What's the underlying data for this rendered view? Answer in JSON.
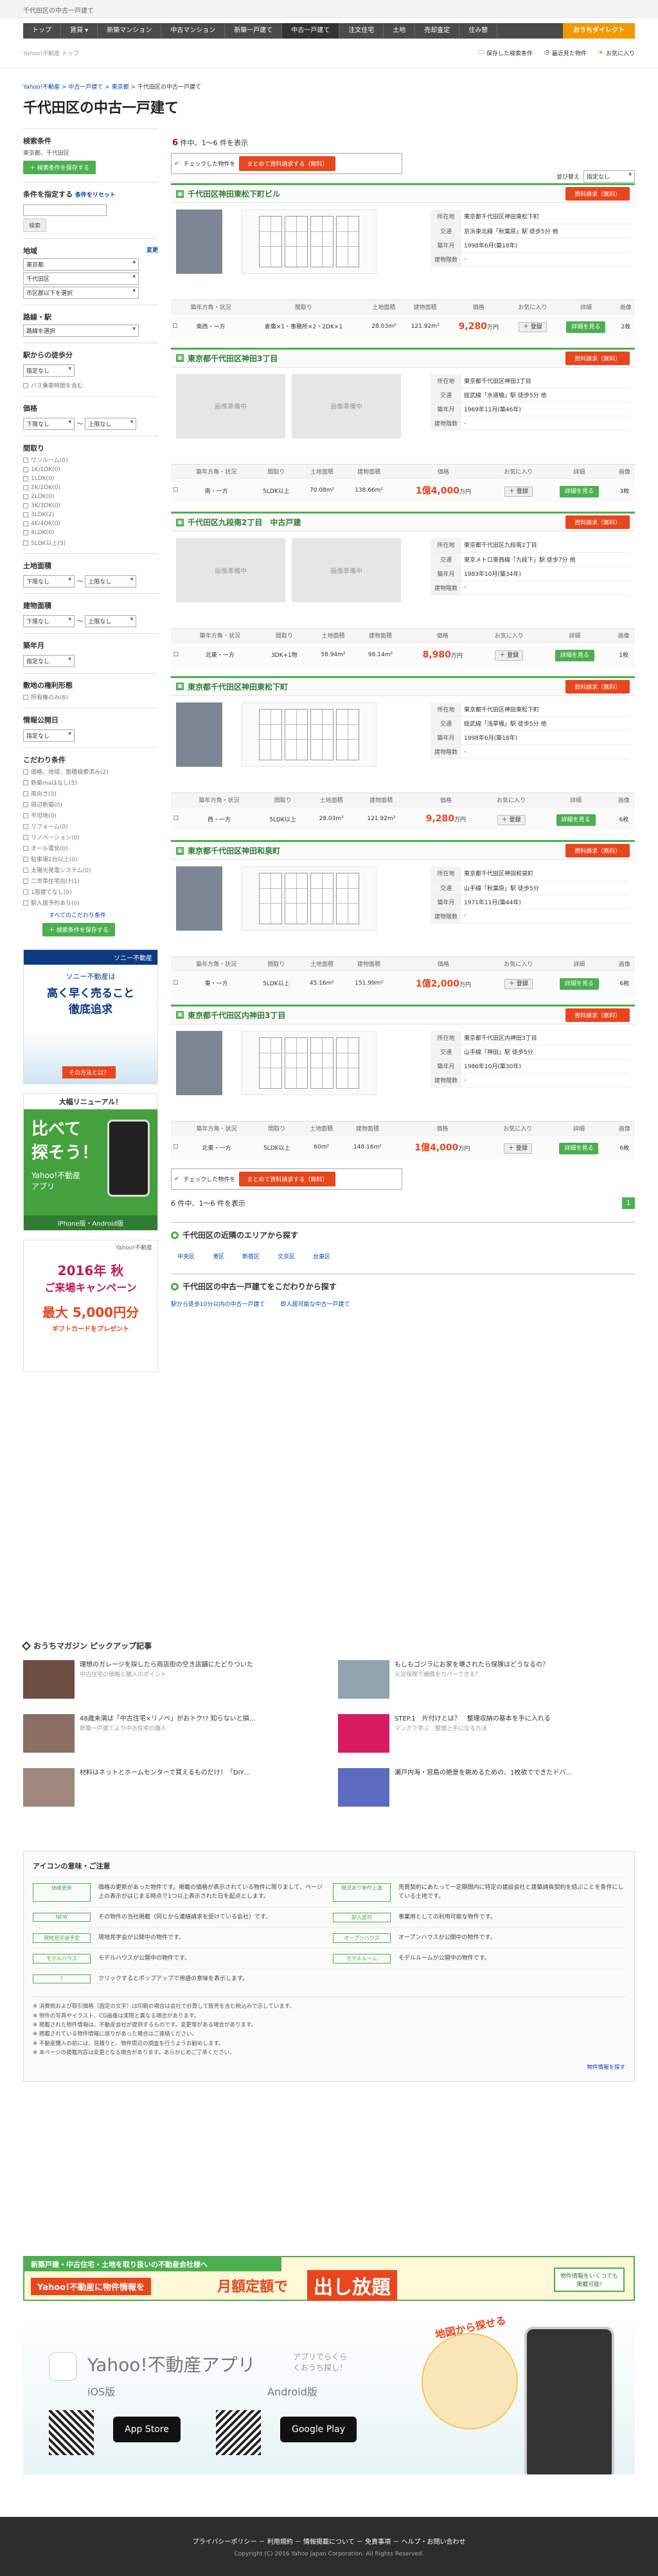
{
  "header": {
    "top_text": "千代田区の中古一戸建て"
  },
  "gnav": {
    "items": [
      "トップ",
      "賃貸 ▾",
      "新築マンション",
      "中古マンション",
      "新築一戸建て",
      "中古一戸建て",
      "注文住宅",
      "土地",
      "売却査定",
      "住み替"
    ],
    "active_index": 5,
    "cta": "おうちダイレクト"
  },
  "tools": {
    "left": "Yahoo!不動産 トップ",
    "save": "保存した検索条件",
    "viewed": "最近見た物件",
    "fav": "お気に入り"
  },
  "breadcrumb": {
    "items": [
      "Yahoo!不動産",
      "中古一戸建て",
      "東京都"
    ],
    "current": "千代田区の中古一戸建て"
  },
  "page_title": "千代田区の中古一戸建て",
  "sidebar": {
    "search_cond": "検索条件",
    "search_cond_txt": "東京都、千代田区",
    "save_btn": "検索条件を保存する",
    "narrow": "条件を指定する",
    "reset": "条件をリセット",
    "keyword_placeholder": "",
    "search_btn": "検索",
    "area": "地域",
    "area_change": "変更",
    "pref": "東京都",
    "city": "千代田区",
    "town": "市区郡以下を選択",
    "route": "路線・駅",
    "route_sel": "路線を選択",
    "walk": "駅からの徒歩分",
    "walk_sel": "指定なし",
    "bus": "バス乗車時間を含む",
    "price": "価格",
    "price_lo": "下限なし",
    "price_hi": "上限なし",
    "tilde": "～",
    "madori": "間取り",
    "madori_items": [
      "ワンルーム(0)",
      "1K/1DK(0)",
      "1LDK(0)",
      "2K/2DK(0)",
      "2LDK(0)",
      "3K/3DK(0)",
      "3LDK(2)",
      "4K/4DK(0)",
      "4LDK(0)",
      "5LDK以上(5)"
    ],
    "land": "土地面積",
    "land_lo": "下限なし",
    "land_hi": "上限なし",
    "bldg": "建物面積",
    "bldg_lo": "下限なし",
    "bldg_hi": "上限なし",
    "age": "築年月",
    "age_sel": "指定なし",
    "cond": "敷地の権利形態",
    "cond_items": [
      "所有権のみ(6)"
    ],
    "upd": "情報公開日",
    "upd_sel": "指定なし",
    "kodawari": "こだわり条件",
    "kodawari_items": [
      "価格、地域、面積検索済み(2)",
      "新築maはなし(5)",
      "南向き(3)",
      "周辺新築(0)",
      "平坦地(0)",
      "リフォーム(0)",
      "リノベーション(0)",
      "オール電化(0)",
      "駐車場2台以上(0)",
      "太陽光発電システム(0)",
      "二世帯住宅向け(1)",
      "1階建てなし(0)",
      "駅入居予約あり(0)"
    ],
    "all_cond": "すべてのこだわり条件",
    "save_btn2": "検索条件を保存する"
  },
  "banners": {
    "sony_head": "ソニー不動産",
    "sony_l1": "ソニー不動産は",
    "sony_l2": "高く早く売ること",
    "sony_l3": "徹底追求",
    "sony_btn": "その方法とは？",
    "app_head": "大幅リニューアル！",
    "app_l1": "比べて",
    "app_l2": "探そう！",
    "app_l3": "Yahoo!不動産",
    "app_l4": "アプリ",
    "app_foot": "iPhone版・Android版",
    "camp_head": "Yahoo!不動産",
    "camp_l1": "2016年 秋",
    "camp_l2": "ご来場キャンペーン",
    "camp_l3": "最大 5,000円分",
    "camp_l4": "ギフトカードをプレゼント"
  },
  "results": {
    "count_pre": "6",
    "count_label": "件中、1～6 件を表示",
    "bulk_label": "チェックした物件を",
    "bulk_btn": "まとめて資料請求する（無料）",
    "sort_label": "並び替え",
    "sort_sel": "指定なし"
  },
  "columns": [
    "築年方角・状況",
    "間取り",
    "土地面積",
    "建物面積",
    "価格",
    "お気に入り",
    "詳細",
    "画像"
  ],
  "info_keys": [
    "所在地",
    "交通",
    "築年月",
    "建物階数"
  ],
  "listings": [
    {
      "title": "千代田区神田東松下町ビル",
      "addr": "東京都千代田区神田東松下町",
      "access": "京浜東北線「秋葉原」駅 徒歩5分 他",
      "built": "1998年6月(築18年)",
      "floors": "-",
      "dir": "南西・一方",
      "madori": "倉庫×1・事務所×2・2DK×1",
      "land": "28.03m²",
      "bldg": "121.92m²",
      "price": "9,280",
      "price_unit": "万円",
      "photos": "2枚",
      "imgtype": "photo"
    },
    {
      "title": "東京都千代田区神田3丁目",
      "addr": "東京都千代田区神田3丁目",
      "access": "総武線「水道橋」駅 徒歩5分 他",
      "built": "1969年11月(築46年)",
      "floors": "-",
      "dir": "南・一方",
      "madori": "5LDK以上",
      "land": "70.08m²",
      "bldg": "138.66m²",
      "price": "1億4,000",
      "price_unit": "万円",
      "photos": "3枚",
      "imgtype": "none"
    },
    {
      "title": "千代田区九段南2丁目　中古戸建",
      "addr": "東京都千代田区九段南2丁目",
      "access": "東京メトロ東西線「九段下」駅 徒歩7分 他",
      "built": "1983年10月(築34年)",
      "floors": "-",
      "dir": "北東・一方",
      "madori": "3DK+1物",
      "land": "58.94m²",
      "bldg": "98.14m²",
      "price": "8,980",
      "price_unit": "万円",
      "photos": "1枚",
      "imgtype": "none"
    },
    {
      "title": "東京都千代田区神田東松下町",
      "addr": "東京都千代田区神田東松下町",
      "access": "総武線「浅草橋」駅 徒歩5分 他",
      "built": "1998年6月(築18年)",
      "floors": "-",
      "dir": "西・一方",
      "madori": "5LDK以上",
      "land": "28.03m²",
      "bldg": "121.92m²",
      "price": "9,280",
      "price_unit": "万円",
      "photos": "6枚",
      "imgtype": "photo"
    },
    {
      "title": "東京都千代田区神田和泉町",
      "addr": "東京都千代田区神田和泉町",
      "access": "山手線「秋葉原」駅 徒歩5分",
      "built": "1971年11月(築44年)",
      "floors": "-",
      "dir": "東・一方",
      "madori": "5LDK以上",
      "land": "45.16m²",
      "bldg": "151.99m²",
      "price": "1億2,000",
      "price_unit": "万円",
      "photos": "6枚",
      "imgtype": "photo"
    },
    {
      "title": "東京都千代田区内神田3丁目",
      "addr": "東京都千代田区内神田3丁目",
      "access": "山手線「神田」駅 徒歩5分",
      "built": "1986年10月(築30年)",
      "floors": "-",
      "dir": "北東・一方",
      "madori": "5LDK以上",
      "land": "60m²",
      "bldg": "148.16m²",
      "price": "1億4,000",
      "price_unit": "万円",
      "photos": "6枚",
      "imgtype": "photo"
    }
  ],
  "card_labels": {
    "req": "資料請求（無料）",
    "fav": "登録",
    "detail": "詳細を見る",
    "noimage": "画像準備中"
  },
  "pager": {
    "text": "6 件中、1～6 件を表示",
    "page": "1"
  },
  "near": {
    "title": "千代田区の近隣のエリアから探す",
    "areas": [
      "中央区",
      "港区",
      "新宿区",
      "文京区",
      "台東区"
    ]
  },
  "kodawari_search": {
    "title": "千代田区の中古一戸建てをこだわりから探す",
    "links": [
      "駅から徒歩10分以内の中古一戸建て",
      "即入居可能な中古一戸建て"
    ]
  },
  "magazine": {
    "title": "おうちマガジン ピックアップ記事",
    "items": [
      {
        "t": "理想のガレージを探したら商店街の空き店舗にたどりついた",
        "s": "中古住宅の価格と購入のポイント"
      },
      {
        "t": "もしもゴジラにお家を壊されたら保険はどうなるの？",
        "s": "火災保険で補償をカバーできる？"
      },
      {
        "t": "48歳未満は「中古住宅×リノベ」がおトク!? 知らないと損…",
        "s": "新築一戸建てより中古住宅の購入"
      },
      {
        "t": "STEP.1　片付けとは？　整理収納の基本を手に入れる",
        "s": "マンガで学ぶ　整理上手になる方法"
      },
      {
        "t": "材料はネットとホームセンターで買えるものだけ！「DIY…",
        "s": ""
      },
      {
        "t": "瀬戸内海・窓島の絶景を眺めるための、1枚欲でできたドバ…",
        "s": ""
      }
    ]
  },
  "legend": {
    "title": "アイコンの意味・ご注意",
    "rows": [
      {
        "b1": "価格更新",
        "t1": "価格の更新があった物件です。掲載の価格が表示されている物件に限りまして、ページ上の表示がはじまる時点で1つ以上表示された日を起点とします。",
        "b2": "現況あり新作上演",
        "t2": "売買契約にあたって一定期間内に特定の建設会社と建築請負契約を結ぶことを条件にしている土地です。"
      },
      {
        "b1": "NEW",
        "t1": "その物件の当社掲載（同じから連絡請求を受けている会社）です。",
        "b2": "即入居可",
        "t2": "事業用としての利用可能な物件です。"
      },
      {
        "b1": "現地見学会予定",
        "t1": "現地見学会が公開中の物件です。",
        "b2": "オープンハウス",
        "t2": "オープンハウスが公開中の物件です。"
      },
      {
        "b1": "モデルハウス",
        "t1": "モデルハウスが公開中の物件です。",
        "b2": "モデルルーム",
        "t2": "モデルルームが公開中の物件です。"
      },
      {
        "b1": "?",
        "t1": "クリックするとポップアップで用語の意味を表示します。",
        "b2": "",
        "t2": ""
      }
    ],
    "notes": [
      "※ 消費税および取引価格（固定の文字）は印刷の場合は会社で計算して販売を含む税込みで示しています。",
      "※ 物件の写真やイラスト、CG画像は実際と異なる場合があります。",
      "※ 掲載された物件情報は、不動産会社が提供するものです。変更等がある場合があります。",
      "※ 掲載されている物件情報に誤りがあった場合はご連絡ください。",
      "※ 不動産購入の前には、見積りと、物件周辺の調査を行うようお勧めします。",
      "※ 本ページの掲載内容は変更となる場合があります。あらかじめご了承ください。"
    ],
    "more": "物件情報を探す"
  },
  "adbanner": {
    "l1": "新築戸建・中古住宅・土地を取り扱いの不動産会社様へ",
    "l2": "Yahoo!不動産に物件情報を",
    "l3": "月額定額で",
    "l4": "出し放題",
    "l5": "物件情報をいくつでも掲載可能!"
  },
  "appbanner": {
    "title": "Yahoo!不動産アプリ",
    "sub": "アプリでらくらくおうち探し！",
    "ios": "iOS版",
    "android": "Android版",
    "appstore": "App Store",
    "gplay": "Google Play",
    "bubble": "地図から探せる"
  },
  "footer": {
    "links": "プライバシーポリシー － 利用規約 － 情報掲載について － 免責事項 － ヘルプ・お問い合わせ",
    "copy": "Copyright (C) 2016 Yahoo Japan Corporation. All Rights Reserved."
  }
}
